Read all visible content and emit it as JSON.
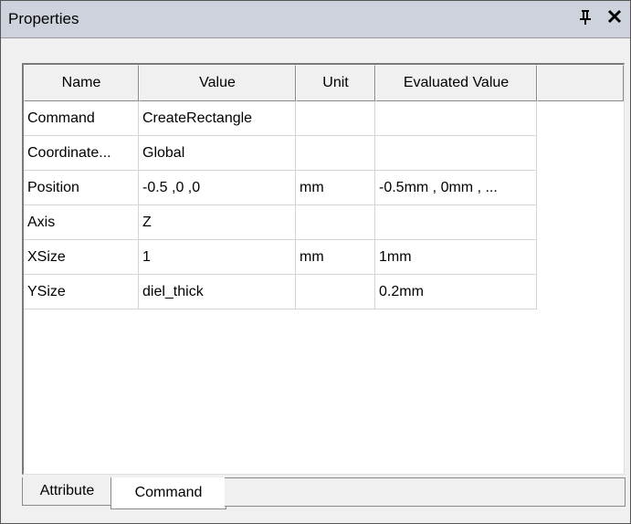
{
  "panel": {
    "title": "Properties",
    "pin_glyph": "p",
    "close_glyph": "×"
  },
  "table": {
    "headers": [
      "Name",
      "Value",
      "Unit",
      "Evaluated Value",
      ""
    ],
    "rows": [
      [
        "Command",
        "CreateRectangle",
        "",
        ""
      ],
      [
        "Coordinate...",
        "Global",
        "",
        ""
      ],
      [
        "Position",
        "-0.5 ,0 ,0",
        "mm",
        "-0.5mm , 0mm , ..."
      ],
      [
        "Axis",
        "Z",
        "",
        ""
      ],
      [
        "XSize",
        "1",
        "mm",
        "1mm"
      ],
      [
        "YSize",
        "diel_thick",
        "",
        "0.2mm"
      ]
    ]
  },
  "tabs": {
    "attribute": "Attribute",
    "command": "Command",
    "active": "Command"
  }
}
